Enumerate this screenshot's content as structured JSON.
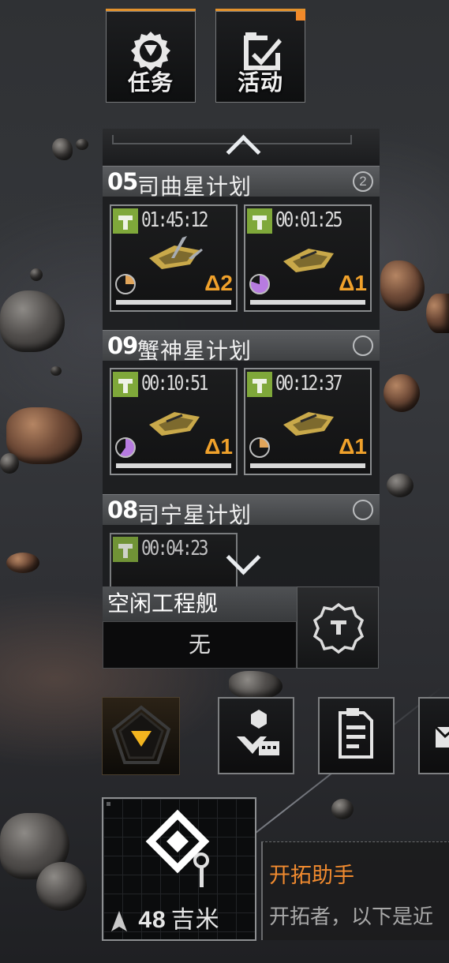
{
  "top_buttons": [
    {
      "label": "任务",
      "icon": "gear-shield-icon"
    },
    {
      "label": "活动",
      "icon": "clipboard-check-icon",
      "has_notification": true
    }
  ],
  "projects": [
    {
      "number": "05",
      "name": "司曲星计划",
      "badge": "2",
      "ships": [
        {
          "timer": "01:45:12",
          "level": "Δ2",
          "progress_color": "#e2a55a"
        },
        {
          "timer": "00:01:25",
          "level": "Δ1",
          "progress_color": "#b77be0"
        }
      ]
    },
    {
      "number": "09",
      "name": "蟹神星计划",
      "badge": "",
      "ships": [
        {
          "timer": "00:10:51",
          "level": "Δ1",
          "progress_color": "#b77be0"
        },
        {
          "timer": "00:12:37",
          "level": "Δ1",
          "progress_color": "#e2a55a"
        }
      ]
    },
    {
      "number": "08",
      "name": "司宁星计划",
      "badge": "",
      "ships": [
        {
          "timer": "00:04:23"
        }
      ]
    }
  ],
  "idle_ships": {
    "label": "空闲工程舰",
    "value": "无"
  },
  "minimap": {
    "distance_value": "48",
    "distance_unit": "吉米"
  },
  "assistant": {
    "title": "开拓助手",
    "message": "开拓者，以下是近"
  },
  "colors": {
    "accent_orange": "#e3922d",
    "level_orange": "#f0a12b",
    "badge_green": "#7fa83a",
    "collapse_yellow": "#f3b51f"
  }
}
